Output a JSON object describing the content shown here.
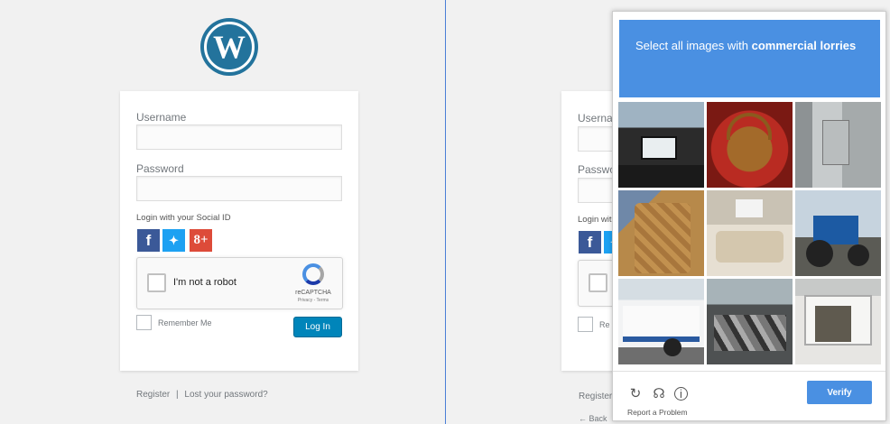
{
  "login": {
    "username_label": "Username",
    "password_label": "Password",
    "social_title": "Login with your Social ID",
    "social": [
      "f",
      "t",
      "8+"
    ],
    "recaptcha_text": "I'm not a robot",
    "recaptcha_brand": "reCAPTCHA",
    "recaptcha_links": "Privacy - Terms",
    "remember_label": "Remember Me",
    "login_button": "Log In",
    "register_link": "Register",
    "lost_password_link": "Lost your password?",
    "separator": "|"
  },
  "right_panel": {
    "username_partial": "Usernar",
    "password_partial": "Passwo",
    "social_partial": "Login wit",
    "remember_partial": "Re",
    "register_partial": "Register",
    "back_partial": "← Back"
  },
  "challenge": {
    "prompt_prefix": "Select all images with ",
    "prompt_target": "commercial lorries",
    "tiles": [
      "vehicle interior with screen",
      "wicker basket with bottles",
      "electrical panel room",
      "leather luggage case",
      "van interior seats",
      "blue tractor",
      "white tow truck",
      "scrap car pile",
      "open box truck"
    ],
    "verify_button": "Verify",
    "report_link": "Report a Problem",
    "icons": [
      "reload-icon",
      "audio-icon",
      "info-icon"
    ]
  },
  "colors": {
    "challenge_blue": "#4a90e2",
    "wp_blue": "#23739c",
    "login_button": "#0085ba",
    "divider": "#4a7fd6"
  }
}
